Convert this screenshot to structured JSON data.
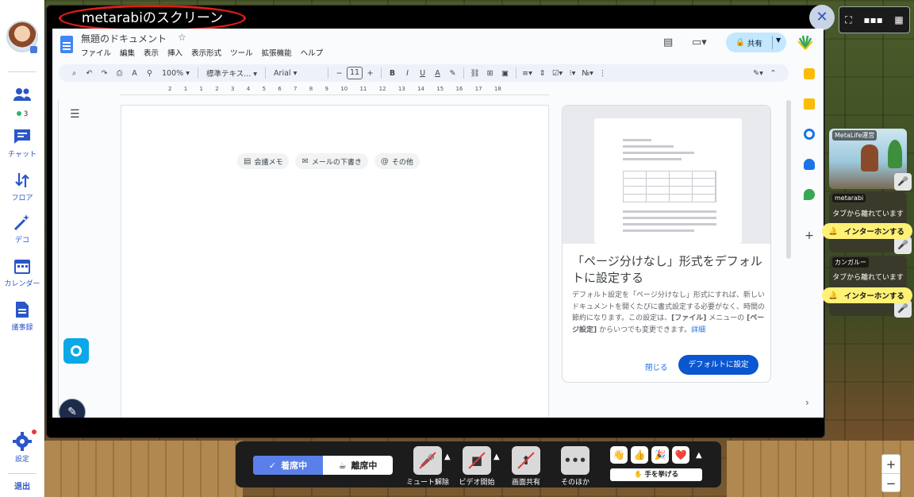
{
  "share": {
    "title": "metarabiのスクリーン",
    "close_glyph": "✕",
    "view_icons": [
      "fullscreen-icon",
      "filmstrip-icon",
      "grid-icon"
    ]
  },
  "sidebar": {
    "member_count": "3",
    "items": [
      {
        "label": "チャット",
        "icon": "chat-icon"
      },
      {
        "label": "フロア",
        "icon": "floor-icon"
      },
      {
        "label": "デコ",
        "icon": "magic-wand-icon"
      },
      {
        "label": "カレンダー",
        "icon": "calendar-icon"
      },
      {
        "label": "議事録",
        "icon": "document-icon"
      }
    ],
    "settings_label": "設定",
    "exit_label": "退出"
  },
  "docs": {
    "title": "無題のドキュメント",
    "menu": [
      "ファイル",
      "編集",
      "表示",
      "挿入",
      "表示形式",
      "ツール",
      "拡張機能",
      "ヘルプ"
    ],
    "share_label": "共有",
    "toolbar": {
      "zoom": "100%",
      "style": "標準テキス...",
      "font": "Arial",
      "font_size": "11"
    },
    "ruler_ticks": [
      "2",
      "1",
      "1",
      "2",
      "3",
      "4",
      "5",
      "6",
      "7",
      "8",
      "9",
      "10",
      "11",
      "12",
      "13",
      "14",
      "15",
      "16",
      "17",
      "18"
    ],
    "chips": [
      {
        "label": "会議メモ",
        "icon": "doc-icon"
      },
      {
        "label": "メールの下書き",
        "icon": "mail-icon"
      },
      {
        "label": "その他",
        "icon": "at-icon"
      }
    ],
    "card": {
      "title": "「ページ分けなし」形式をデフォルトに設定する",
      "body_pre": "デフォルト設定を「ページ分けなし」形式にすれば、新しいドキュメントを開くたびに書式設定する必要がなく、時間の節約になります。この設定は、",
      "body_b1": "[ファイル]",
      "body_mid": " メニューの ",
      "body_b2": "[ページ設定]",
      "body_post": " からいつでも変更できます。",
      "body_link": "詳細",
      "close_label": "閉じる",
      "default_label": "デフォルトに設定"
    }
  },
  "participants": [
    {
      "name": "MetaLife運営",
      "status": ""
    },
    {
      "name": "metarabi",
      "status": "タブから離れています",
      "intercom": "インターホンする"
    },
    {
      "name": "カンガルー",
      "status": "タブから離れています",
      "intercom": "インターホンする"
    }
  ],
  "controls": {
    "seat_on": "着席中",
    "seat_off": "離席中",
    "buttons": [
      {
        "label": "ミュート解除",
        "icon": "mic-icon"
      },
      {
        "label": "ビデオ開始",
        "icon": "camera-icon"
      },
      {
        "label": "画面共有",
        "icon": "screen-share-icon"
      },
      {
        "label": "そのほか",
        "icon": "more-icon"
      }
    ],
    "reactions": [
      "👋",
      "👍",
      "🎉",
      "❤️"
    ],
    "raise_hand": "✋ 手を挙げる"
  },
  "zoom": {
    "plus": "+",
    "minus": "−"
  },
  "colors": {
    "accent": "#2a56c8",
    "seat_on": "#5a7fe8",
    "intercom": "#fff176",
    "share_button": "#c2e7ff",
    "highlight_ring": "#e01b1b"
  }
}
